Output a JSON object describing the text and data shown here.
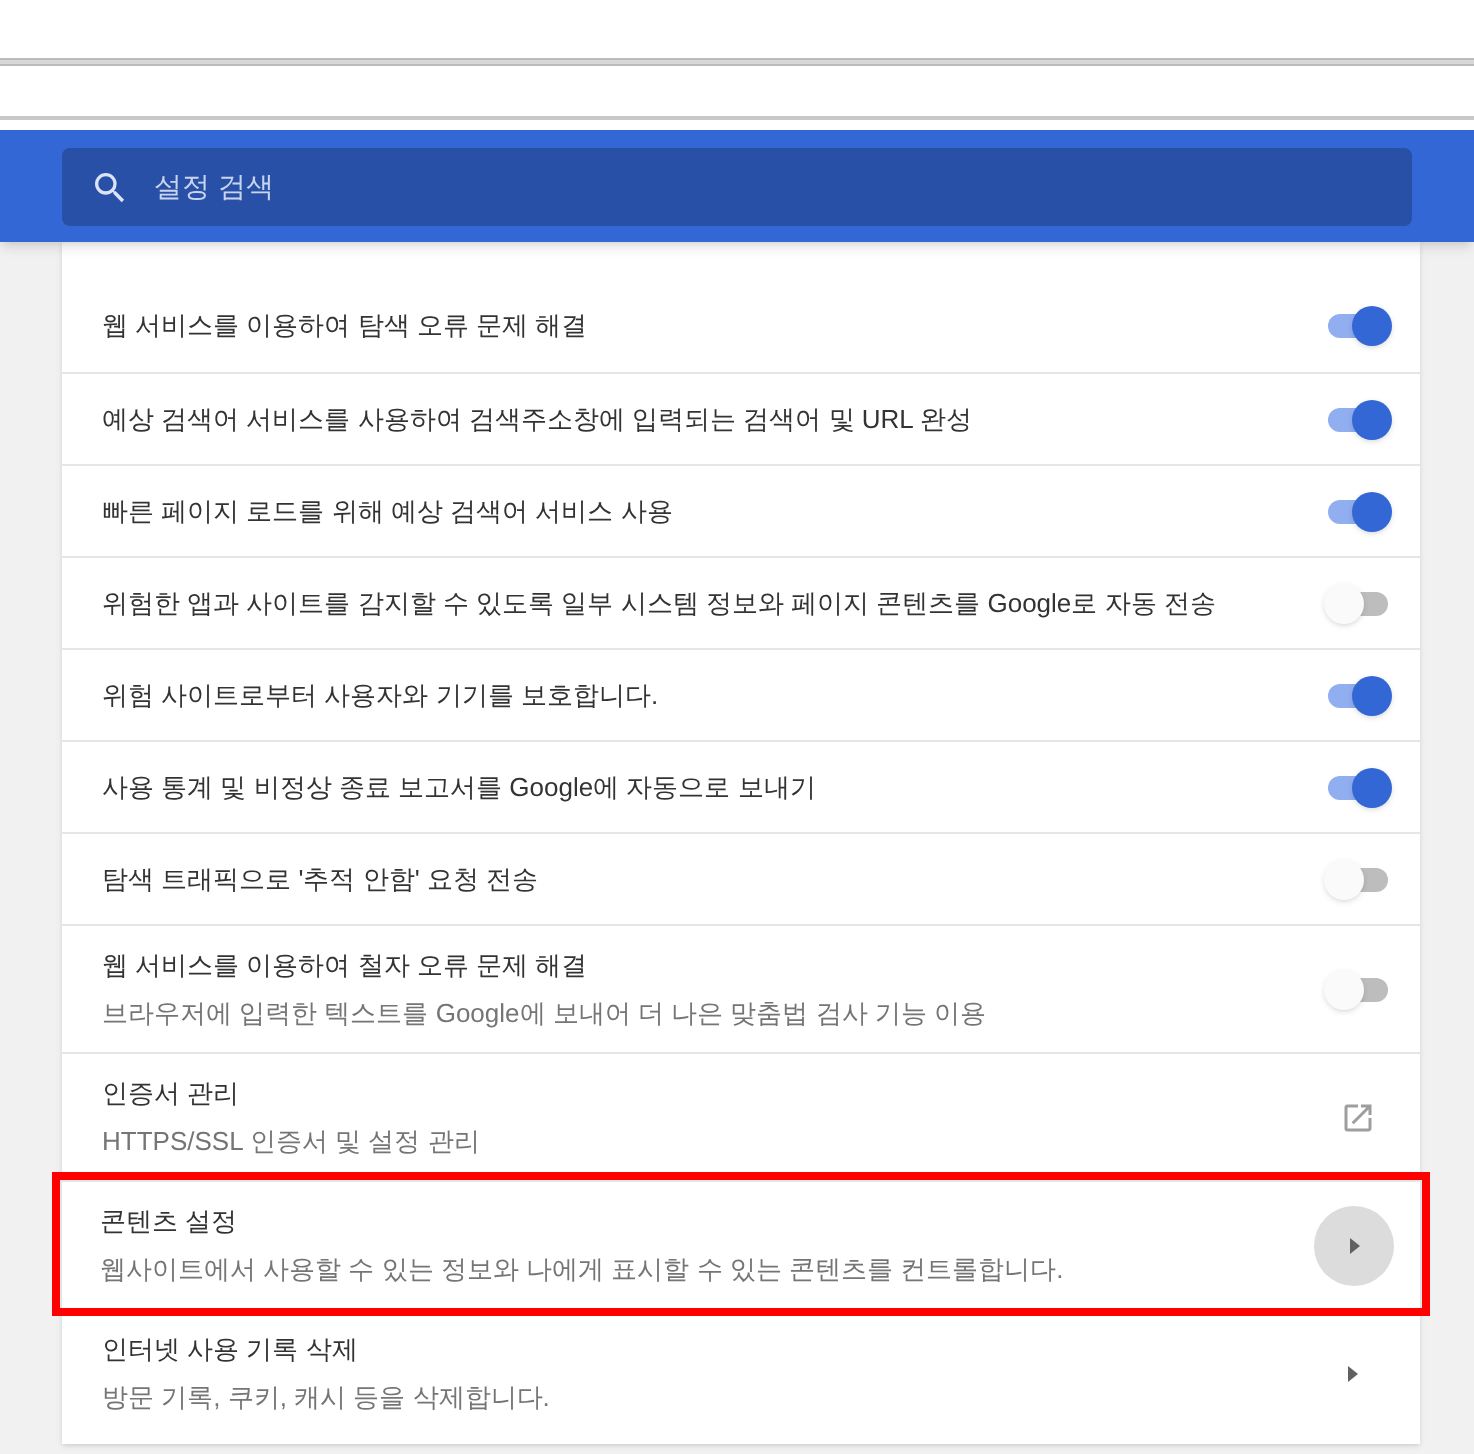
{
  "search": {
    "placeholder": "설정 검색"
  },
  "rows": [
    {
      "kind": "toggle",
      "title": "웹 서비스를 이용하여 탐색 오류 문제 해결",
      "on": true,
      "highlighted": false
    },
    {
      "kind": "toggle",
      "title": "예상 검색어 서비스를 사용하여 검색주소창에 입력되는 검색어 및 URL 완성",
      "on": true,
      "highlighted": false
    },
    {
      "kind": "toggle",
      "title": "빠른 페이지 로드를 위해 예상 검색어 서비스 사용",
      "on": true,
      "highlighted": false
    },
    {
      "kind": "toggle",
      "title": "위험한 앱과 사이트를 감지할 수 있도록 일부 시스템 정보와 페이지 콘텐츠를 Google로 자동 전송",
      "on": false,
      "highlighted": false
    },
    {
      "kind": "toggle",
      "title": "위험 사이트로부터 사용자와 기기를 보호합니다.",
      "on": true,
      "highlighted": false
    },
    {
      "kind": "toggle",
      "title": "사용 통계 및 비정상 종료 보고서를 Google에 자동으로 보내기",
      "on": true,
      "highlighted": false
    },
    {
      "kind": "toggle",
      "title": "탐색 트래픽으로 '추적 안함' 요청 전송",
      "on": false,
      "highlighted": false
    },
    {
      "kind": "toggle",
      "title": "웹 서비스를 이용하여 철자 오류 문제 해결",
      "subtitle": "브라우저에 입력한 텍스트를 Google에 보내어 더 나은 맞춤법 검사 기능 이용",
      "on": false,
      "highlighted": false
    },
    {
      "kind": "external",
      "title": "인증서 관리",
      "subtitle": "HTTPS/SSL 인증서 및 설정 관리",
      "highlighted": false
    },
    {
      "kind": "arrow",
      "title": "콘텐츠 설정",
      "subtitle": "웹사이트에서 사용할 수 있는 정보와 나에게 표시할 수 있는 콘텐츠를 컨트롤합니다.",
      "highlighted": true
    },
    {
      "kind": "arrow",
      "title": "인터넷 사용 기록 삭제",
      "subtitle": "방문 기록, 쿠키, 캐시 등을 삭제합니다.",
      "highlighted": false
    }
  ]
}
